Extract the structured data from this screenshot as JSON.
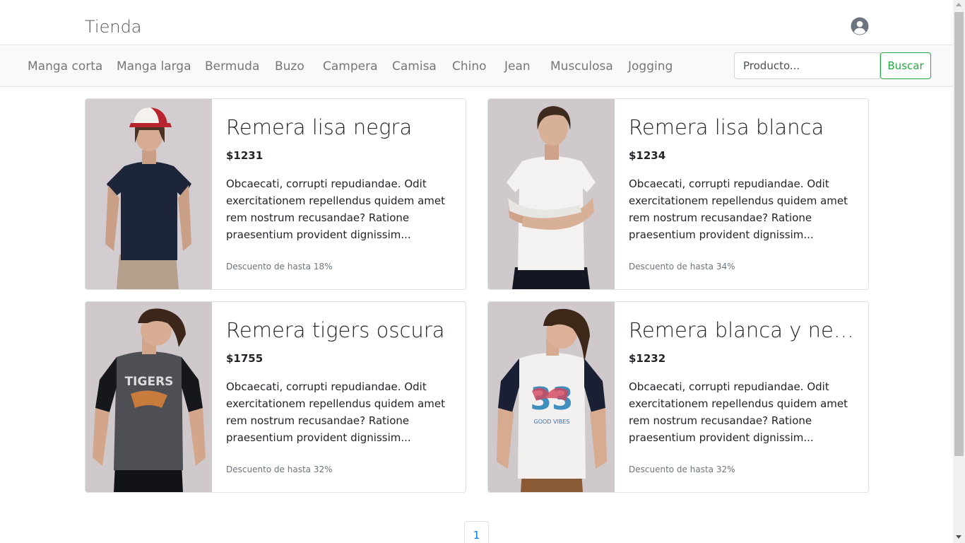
{
  "header": {
    "brand": "Tienda",
    "user_icon": "user-circle-icon"
  },
  "nav": {
    "items": [
      {
        "label": "Manga corta"
      },
      {
        "label": "Manga larga"
      },
      {
        "label": "Bermuda"
      },
      {
        "label": "Buzo"
      },
      {
        "label": "Campera"
      },
      {
        "label": "Camisa"
      },
      {
        "label": "Chino"
      },
      {
        "label": "Jean"
      },
      {
        "label": "Musculosa"
      },
      {
        "label": "Jogging"
      }
    ]
  },
  "search": {
    "placeholder": "Producto...",
    "value": "",
    "button_label": "Buscar"
  },
  "products": [
    {
      "title": "Remera lisa negra",
      "price": "$1231",
      "description": "Obcaecati, corrupti repudiandae. Odit exercitationem repellendus quidem amet rem nostrum recusandae? Ratione praesentium provident dignissim...",
      "discount": "Descuento de hasta 18%"
    },
    {
      "title": "Remera lisa blanca",
      "price": "$1234",
      "description": "Obcaecati, corrupti repudiandae. Odit exercitationem repellendus quidem amet rem nostrum recusandae? Ratione praesentium provident dignissim...",
      "discount": "Descuento de hasta 34%"
    },
    {
      "title": "Remera tigers oscura",
      "price": "$1755",
      "description": "Obcaecati, corrupti repudiandae. Odit exercitationem repellendus quidem amet rem nostrum recusandae? Ratione praesentium provident dignissim...",
      "discount": "Descuento de hasta 32%"
    },
    {
      "title": "Remera blanca y negr...",
      "price": "$1232",
      "description": "Obcaecati, corrupti repudiandae. Odit exercitationem repellendus quidem amet rem nostrum recusandae? Ratione praesentium provident dignissim...",
      "discount": "Descuento de hasta 32%"
    }
  ],
  "pagination": {
    "current_page": "1"
  },
  "colors": {
    "accent_green": "#28a745",
    "link_blue": "#007bff",
    "navbar_bg": "#f8f9fa"
  }
}
